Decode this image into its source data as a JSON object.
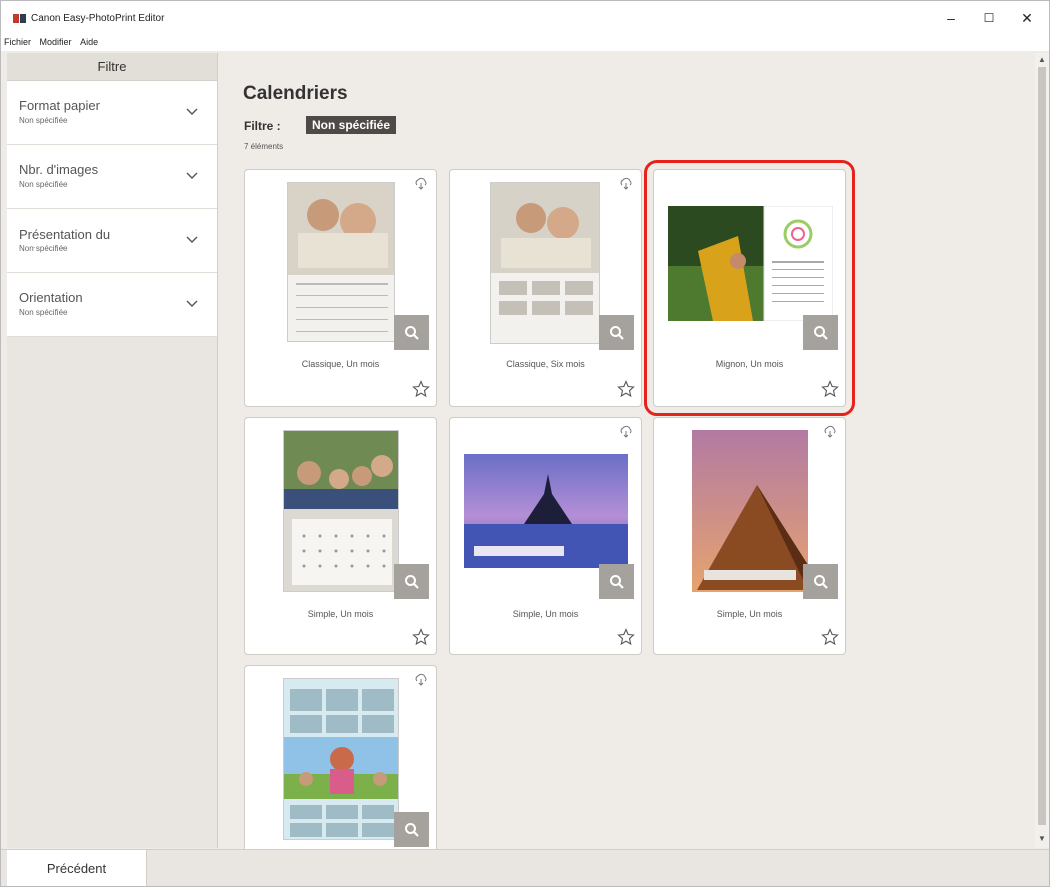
{
  "window": {
    "title": "Canon Easy-PhotoPrint Editor",
    "minimize_glyph": "–",
    "maximize_glyph": "☐",
    "close_glyph": "✕"
  },
  "menu": {
    "items": [
      "Fichier",
      "Modifier",
      "Aide"
    ]
  },
  "sidebar": {
    "header": "Filtre",
    "filters": [
      {
        "label": "Format papier",
        "value": "Non spécifiée"
      },
      {
        "label": "Nbr. d'images",
        "value": "Non spécifiée"
      },
      {
        "label": "Présentation du calendrier",
        "value": "Non spécifiée"
      },
      {
        "label": "Orientation",
        "value": "Non spécifiée"
      }
    ]
  },
  "main": {
    "heading": "Calendriers",
    "filter_label": "Filtre :",
    "filter_chip": "Non spécifiée",
    "count": "7 éléments",
    "accent_color": "#e5231b",
    "templates": [
      {
        "name": "Classique, Un mois",
        "selected": false,
        "icon": "cloud-download-icon"
      },
      {
        "name": "Classique, Six mois",
        "selected": false,
        "icon": "cloud-download-icon"
      },
      {
        "name": "Mignon, Un mois",
        "selected": true,
        "icon": "cloud-download-icon"
      },
      {
        "name": "Simple, Un mois",
        "selected": false,
        "icon": "none"
      },
      {
        "name": "Simple, Un mois",
        "selected": false,
        "icon": "cloud-download-icon"
      },
      {
        "name": "Simple, Un mois",
        "selected": false,
        "icon": "cloud-download-icon"
      },
      {
        "name": "",
        "selected": false,
        "icon": "cloud-download-icon"
      }
    ]
  },
  "footer": {
    "back_label": "Précédent"
  }
}
